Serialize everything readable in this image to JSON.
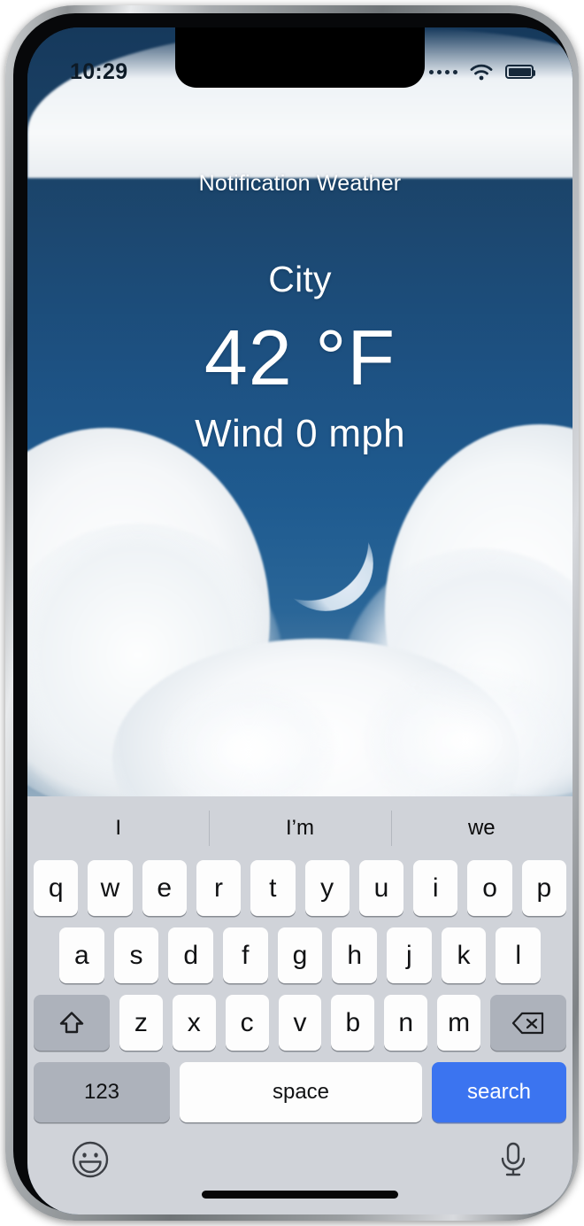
{
  "status_bar": {
    "time": "10:29",
    "signal_icon": "signal-dots-icon",
    "wifi_icon": "wifi-icon",
    "battery_icon": "battery-icon"
  },
  "weather": {
    "app_title": "Notification Weather",
    "city": "City",
    "temperature": "42 °F",
    "wind": "Wind 0 mph",
    "moon_icon": "crescent-moon-icon",
    "sky_top_color": "#16395c",
    "sky_bottom_color": "#93acc0"
  },
  "keyboard": {
    "suggestions": [
      "I",
      "I’m",
      "we"
    ],
    "row_qwerty": [
      "q",
      "w",
      "e",
      "r",
      "t",
      "y",
      "u",
      "i",
      "o",
      "p"
    ],
    "row_asdf": [
      "a",
      "s",
      "d",
      "f",
      "g",
      "h",
      "j",
      "k",
      "l"
    ],
    "row_zxcv": [
      "z",
      "x",
      "c",
      "v",
      "b",
      "n",
      "m"
    ],
    "shift_icon": "shift-arrow-icon",
    "backspace_icon": "backspace-icon",
    "numbers_label": "123",
    "space_label": "space",
    "search_label": "search",
    "search_key_color": "#3b74f0",
    "emoji_icon": "emoji-smiley-icon",
    "mic_icon": "microphone-icon",
    "background_color": "#d0d3d9"
  }
}
